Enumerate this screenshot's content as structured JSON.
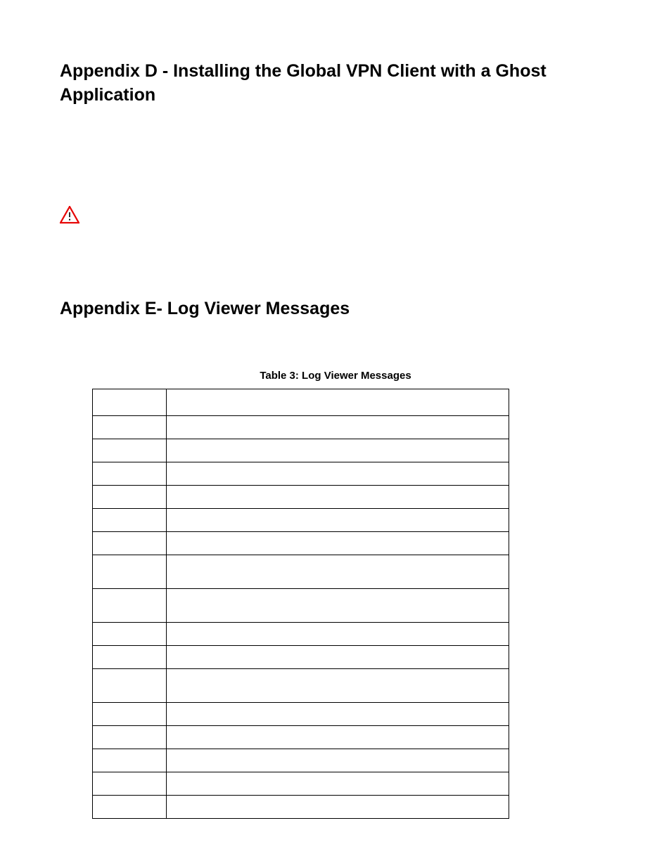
{
  "appendix_d": {
    "title": "Appendix D - Installing the Global VPN Client with a Ghost Application"
  },
  "alert": {
    "icon": "warning-triangle"
  },
  "appendix_e": {
    "title": "Appendix E- Log Viewer Messages"
  },
  "table": {
    "caption": "Table 3: Log Viewer Messages",
    "rows": [
      {
        "type": "",
        "message": "",
        "rowClass": "row-h1"
      },
      {
        "type": "",
        "message": "",
        "rowClass": "row-h2"
      },
      {
        "type": "",
        "message": "",
        "rowClass": "row-h2"
      },
      {
        "type": "",
        "message": "",
        "rowClass": "row-h2"
      },
      {
        "type": "",
        "message": "",
        "rowClass": "row-h2"
      },
      {
        "type": "",
        "message": "",
        "rowClass": "row-h2"
      },
      {
        "type": "",
        "message": "",
        "rowClass": "row-h2"
      },
      {
        "type": "",
        "message": "",
        "rowClass": "row-h3"
      },
      {
        "type": "",
        "message": "",
        "rowClass": "row-h3"
      },
      {
        "type": "",
        "message": "",
        "rowClass": "row-h2"
      },
      {
        "type": "",
        "message": "",
        "rowClass": "row-h2"
      },
      {
        "type": "",
        "message": "",
        "rowClass": "row-h3"
      },
      {
        "type": "",
        "message": "",
        "rowClass": "row-h2"
      },
      {
        "type": "",
        "message": "",
        "rowClass": "row-h2"
      },
      {
        "type": "",
        "message": "",
        "rowClass": "row-h2"
      },
      {
        "type": "",
        "message": "",
        "rowClass": "row-h2"
      },
      {
        "type": "",
        "message": "",
        "rowClass": "row-h2"
      }
    ]
  }
}
